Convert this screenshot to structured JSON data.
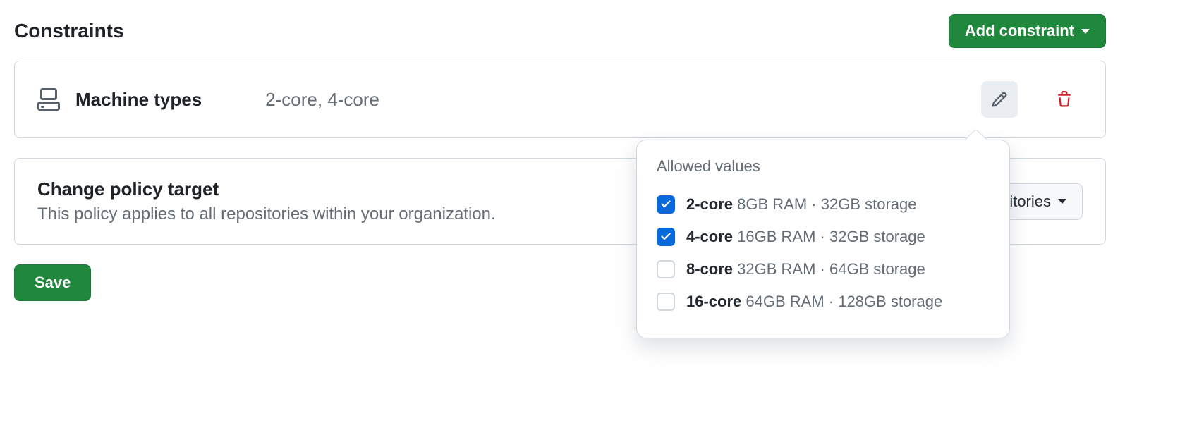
{
  "header": {
    "title": "Constraints",
    "add_button": "Add constraint"
  },
  "constraint": {
    "name": "Machine types",
    "summary": "2-core, 4-core"
  },
  "popover": {
    "title": "Allowed values",
    "options": [
      {
        "core": "2-core",
        "spec": "8GB RAM · 32GB storage",
        "checked": true
      },
      {
        "core": "4-core",
        "spec": "16GB RAM · 32GB storage",
        "checked": true
      },
      {
        "core": "8-core",
        "spec": "32GB RAM · 64GB storage",
        "checked": false
      },
      {
        "core": "16-core",
        "spec": "64GB RAM · 128GB storage",
        "checked": false
      }
    ]
  },
  "policy": {
    "title": "Change policy target",
    "description": "This policy applies to all repositories within your organization.",
    "repo_button": "All repositories"
  },
  "save_button": "Save"
}
